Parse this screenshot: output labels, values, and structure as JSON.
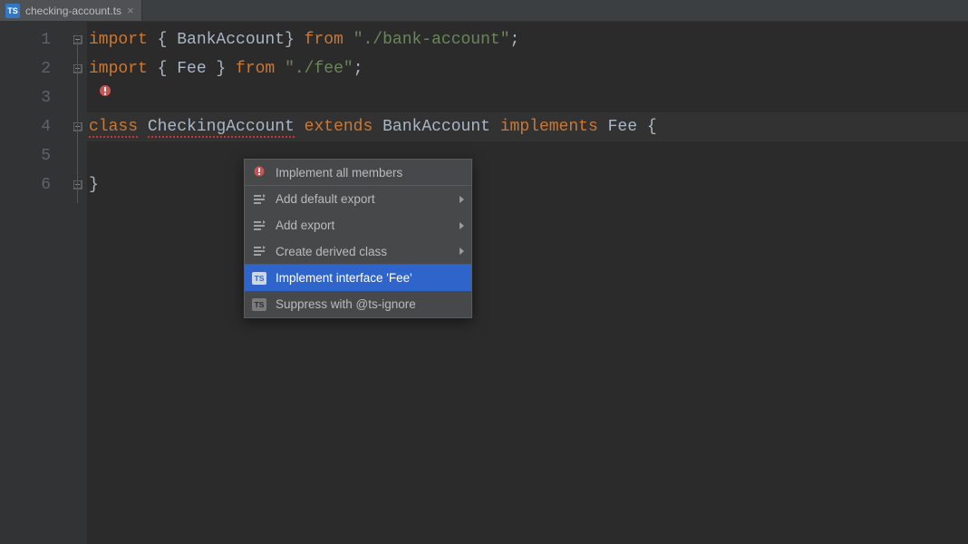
{
  "tab": {
    "filename": "checking-account.ts",
    "icon": "TS"
  },
  "code": {
    "l1": {
      "kw1": "import",
      "p1": " { ",
      "t1": "BankAccount",
      "p2": "} ",
      "kw2": "from",
      "sp": " ",
      "str": "\"./bank-account\"",
      "semi": ";"
    },
    "l2": {
      "kw1": "import",
      "p1": " { ",
      "t1": "Fee",
      "p2": " } ",
      "kw2": "from",
      "sp": " ",
      "str": "\"./fee\"",
      "semi": ";"
    },
    "l4": {
      "kw1": "class",
      "sp1": " ",
      "cls": "CheckingAccount",
      "sp2": " ",
      "kw2": "extends",
      "sp3": " ",
      "sup": "BankAccount",
      "sp4": " ",
      "kw3": "implements",
      "sp5": " ",
      "iface": "Fee",
      "sp6": " ",
      "brace": "{"
    },
    "l6": {
      "brace": "}"
    }
  },
  "lineNumbers": [
    "1",
    "2",
    "3",
    "4",
    "5",
    "6"
  ],
  "popup": {
    "items": [
      {
        "label": "Implement all members"
      },
      {
        "label": "Add default export"
      },
      {
        "label": "Add export"
      },
      {
        "label": "Create derived class"
      },
      {
        "label": "Implement interface 'Fee'"
      },
      {
        "label": "Suppress with @ts-ignore"
      }
    ]
  }
}
